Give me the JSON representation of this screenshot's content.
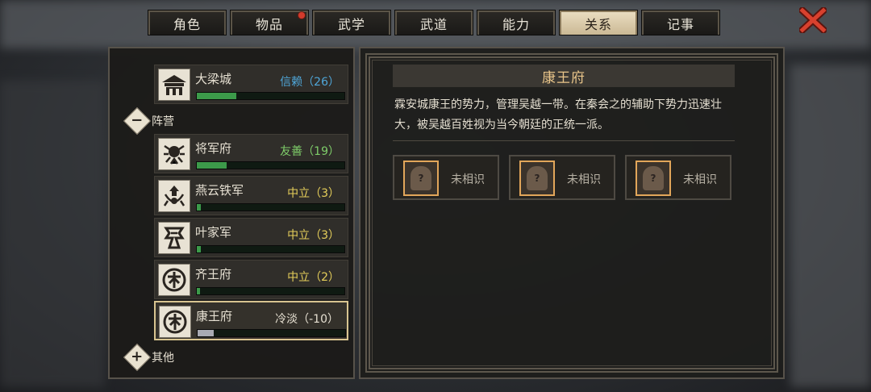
{
  "tabs": [
    {
      "label": "角色"
    },
    {
      "label": "物品"
    },
    {
      "label": "武学"
    },
    {
      "label": "武道"
    },
    {
      "label": "能力"
    },
    {
      "label": "关系"
    },
    {
      "label": "记事"
    }
  ],
  "active_tab": "关系",
  "colors": {
    "accent": "#e9c58a",
    "trust": "#4fa6d8",
    "friendly": "#7fce6a",
    "neutral": "#e6cf5a",
    "cold": "#e6e0d2",
    "bar_green": "#3c9a4a",
    "bar_gray": "#a8aab2"
  },
  "left": {
    "top_item": {
      "name": "大梁城",
      "status": "信赖（26）",
      "level": 0.27
    },
    "group_camp": {
      "label": "阵营"
    },
    "camp_items": [
      {
        "name": "将军府",
        "status": "友善（19）",
        "level": 0.2
      },
      {
        "name": "燕云铁军",
        "status": "中立（3）",
        "level": 0.03
      },
      {
        "name": "叶家军",
        "status": "中立（3）",
        "level": 0.03
      },
      {
        "name": "齐王府",
        "status": "中立（2）",
        "level": 0.02
      },
      {
        "name": "康王府",
        "status": "冷淡（-10）",
        "level": 0.11
      }
    ],
    "group_other": {
      "label": "其他"
    }
  },
  "detail": {
    "title": "康王府",
    "description": "霖安城康王的势力，管理吴越一带。在秦会之的辅助下势力迅速壮大，被吴越百姓视为当今朝廷的正统一派。",
    "members": [
      {
        "label": "未相识"
      },
      {
        "label": "未相识"
      },
      {
        "label": "未相识"
      }
    ]
  }
}
